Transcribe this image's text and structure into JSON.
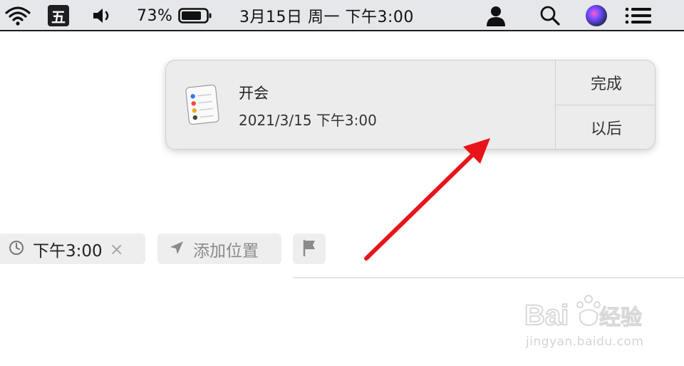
{
  "menubar": {
    "ime_label": "五",
    "battery_percent": "73%",
    "datetime": "3月15日 周一 下午3:00",
    "icons": [
      "wifi-icon",
      "input-method-icon",
      "volume-icon",
      "battery-icon",
      "user-icon",
      "search-icon",
      "siri-icon",
      "notification-center-icon"
    ]
  },
  "notification": {
    "title": "开会",
    "subtitle": "2021/3/15 下午3:00",
    "icon": "reminders-app-icon",
    "actions": {
      "done": "完成",
      "later": "以后"
    }
  },
  "reminder_options": {
    "time_chip": "下午3:00",
    "clear_icon": "×",
    "location_chip": "添加位置",
    "icons": [
      "clock-icon",
      "location-arrow-icon",
      "flag-icon"
    ]
  },
  "annotation": {
    "arrow_color": "#e8141a"
  },
  "watermark": {
    "logo_text": "Baidu经验",
    "url": "jingyan.baidu.com"
  }
}
